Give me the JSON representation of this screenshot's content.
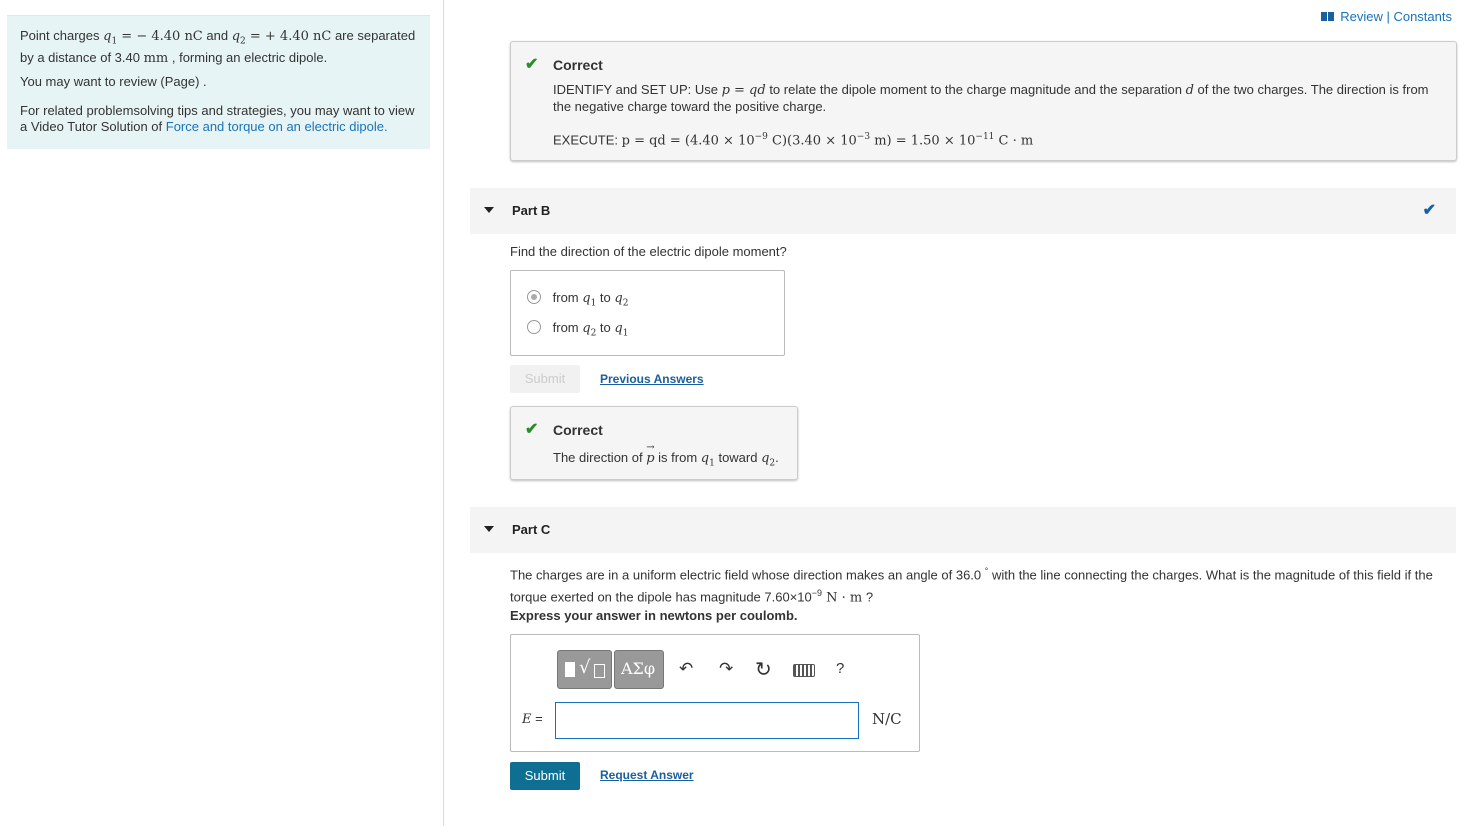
{
  "nav": {
    "review": "Review",
    "sep": " | ",
    "constants": "Constants"
  },
  "problem": {
    "p1_a": "Point charges ",
    "q1": "q",
    "q1_sub": "1",
    "p1_eq1": " = − 4.40 ",
    "unit_nC": "nC",
    "p1_and": " and ",
    "q2": "q",
    "q2_sub": "2",
    "p1_eq2": " = + 4.40 ",
    "p1_b": " are separated by a distance of 3.40 ",
    "unit_mm": "mm",
    "p1_c": " , forming an electric dipole.",
    "p2": "You may want to review (Page) .",
    "p3_a": "For related problemsolving tips and strategies, you may want to view a Video Tutor Solution of ",
    "p3_link": "Force and torque on an electric dipole."
  },
  "partA_feedback": {
    "label": "Correct",
    "identify_a": "IDENTIFY and SET UP: Use ",
    "identify_eq": "p = qd",
    "identify_b": " to relate the dipole moment to the charge magnitude and the separation ",
    "identify_d": "d",
    "identify_c": " of the two charges. The direction is from the negative charge toward the positive charge.",
    "execute_label": "EXECUTE: ",
    "execute_eq1": "p = qd = (4.40 × 10",
    "execute_exp1": "−9",
    "execute_eq2": " C)(3.40 × 10",
    "execute_exp2": "−3",
    "execute_eq3": " m) = 1.50 × 10",
    "execute_exp3": "−11",
    "execute_eq4": " C · m"
  },
  "partB": {
    "title": "Part B",
    "question": "Find the direction of the electric dipole moment?",
    "options": [
      {
        "pre": "from ",
        "a": "q",
        "a_sub": "1",
        "mid": " to ",
        "b": "q",
        "b_sub": "2"
      },
      {
        "pre": "from ",
        "a": "q",
        "a_sub": "2",
        "mid": " to ",
        "b": "q",
        "b_sub": "1"
      }
    ],
    "selected_index": 0,
    "submit": "Submit",
    "previous_answers": "Previous Answers",
    "feedback_label": "Correct",
    "feedback_a": "The direction of ",
    "feedback_p": "p",
    "feedback_b": " is from ",
    "feedback_q1": "q",
    "feedback_q1_sub": "1",
    "feedback_c": " toward ",
    "feedback_q2": "q",
    "feedback_q2_sub": "2",
    "feedback_d": "."
  },
  "partC": {
    "title": "Part C",
    "question_a": "The charges are in a uniform electric field whose direction makes an angle of 36.0 ",
    "degree": "°",
    "question_b": " with the line connecting the charges. What is the magnitude of this field if the torque exerted on the dipole has magnitude 7.60×10",
    "question_exp": "−9",
    "question_unit": " N · m",
    "question_c": " ?",
    "instruction": "Express your answer in newtons per coulomb.",
    "toolbar": {
      "templates": "√",
      "greek": "ΑΣφ",
      "help": "?"
    },
    "var_label": "E",
    "equals": " =",
    "answer_value": "",
    "unit": "N/C",
    "submit": "Submit",
    "request_answer": "Request Answer"
  },
  "colors": {
    "accent": "#1a73b8",
    "submit_bg": "#0e6f93",
    "correct_green": "#2a8c2a",
    "panel_bg": "#e7f4f6"
  }
}
